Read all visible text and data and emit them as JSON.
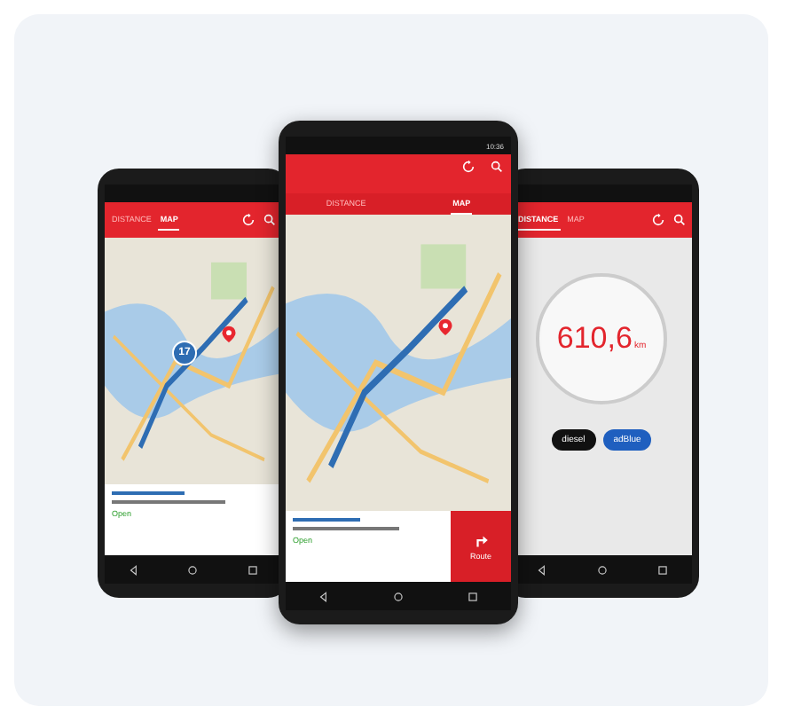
{
  "phones": [
    {
      "kind": "map",
      "tabs": [
        {
          "label": "DISTANCE",
          "selected": false
        },
        {
          "label": "MAP",
          "selected": true
        }
      ],
      "route_badge": "17",
      "card": {
        "status": "Open"
      }
    },
    {
      "kind": "map",
      "time": "10:36",
      "tabs": [
        {
          "label": "DISTANCE",
          "selected": false
        },
        {
          "label": "MAP",
          "selected": true
        }
      ],
      "card": {
        "status": "Open",
        "route_button": "Route"
      }
    },
    {
      "kind": "distance",
      "tabs": [
        {
          "label": "DISTANCE",
          "selected": true
        },
        {
          "label": "MAP",
          "selected": false
        }
      ],
      "reading": "610,6",
      "unit": "km",
      "fuels": [
        {
          "label": "diesel",
          "color": "#111111"
        },
        {
          "label": "adBlue",
          "color": "#1f5fbf"
        }
      ]
    }
  ]
}
